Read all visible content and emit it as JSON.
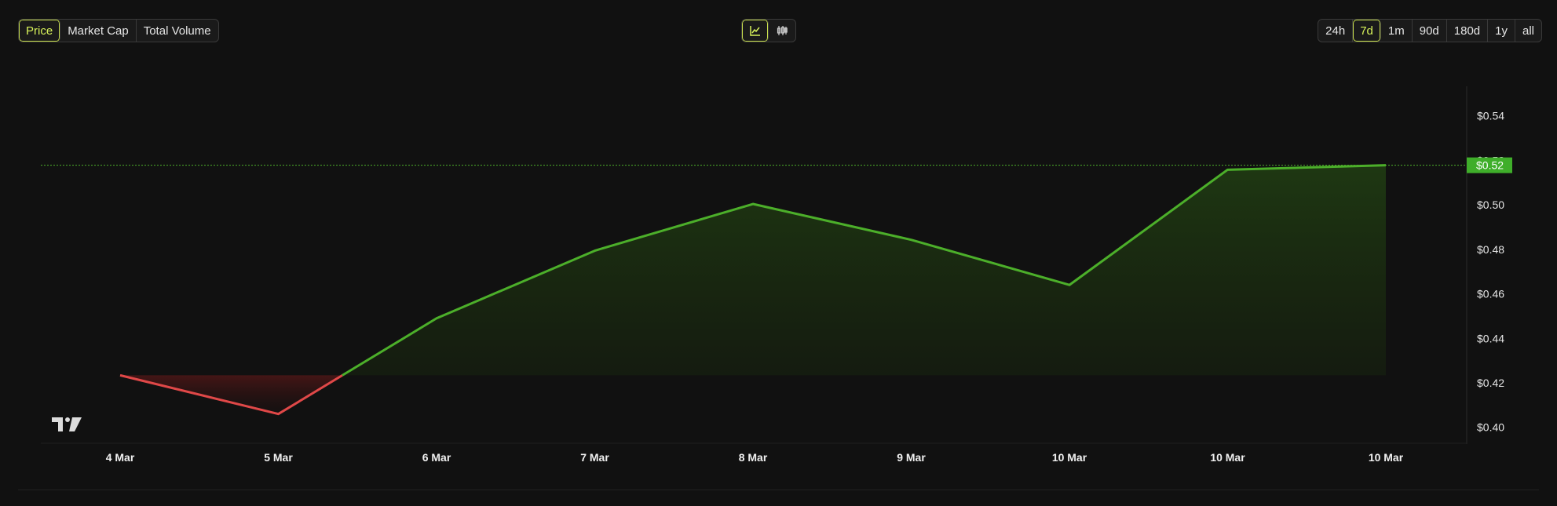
{
  "metric_tabs": [
    "Price",
    "Market Cap",
    "Total Volume"
  ],
  "metric_active": 0,
  "chart_types": [
    {
      "icon": "line-chart-icon",
      "active": true
    },
    {
      "icon": "candlestick-icon",
      "active": false
    }
  ],
  "ranges": [
    "24h",
    "7d",
    "1m",
    "90d",
    "180d",
    "1y",
    "all"
  ],
  "range_active": 1,
  "current_price_label": "$0.52",
  "colors": {
    "up": "#4caf2a",
    "down": "#e04848",
    "accent": "#d7f25a",
    "price_tag": "#3fae2a"
  },
  "chart_data": {
    "type": "area",
    "x": [
      "4 Mar",
      "5 Mar",
      "6 Mar",
      "7 Mar",
      "8 Mar",
      "9 Mar",
      "10 Mar",
      "10 Mar",
      "10 Mar"
    ],
    "values": [
      0.4234,
      0.406,
      0.449,
      0.4794,
      0.5004,
      0.4843,
      0.464,
      0.5158,
      0.5178
    ],
    "baseline": 0.4234,
    "current": 0.5178,
    "y_ticks": [
      "$0.40",
      "$0.42",
      "$0.44",
      "$0.46",
      "$0.48",
      "$0.50",
      "$0.52",
      "$0.54"
    ],
    "y_tick_values": [
      0.4,
      0.42,
      0.44,
      0.46,
      0.48,
      0.5,
      0.52,
      0.54
    ],
    "x_ticks": [
      "4 Mar",
      "5 Mar",
      "6 Mar",
      "7 Mar",
      "8 Mar",
      "9 Mar",
      "10 Mar",
      "10 Mar",
      "10 Mar"
    ],
    "ylim": [
      0.3925,
      0.5533
    ],
    "grid": false
  }
}
